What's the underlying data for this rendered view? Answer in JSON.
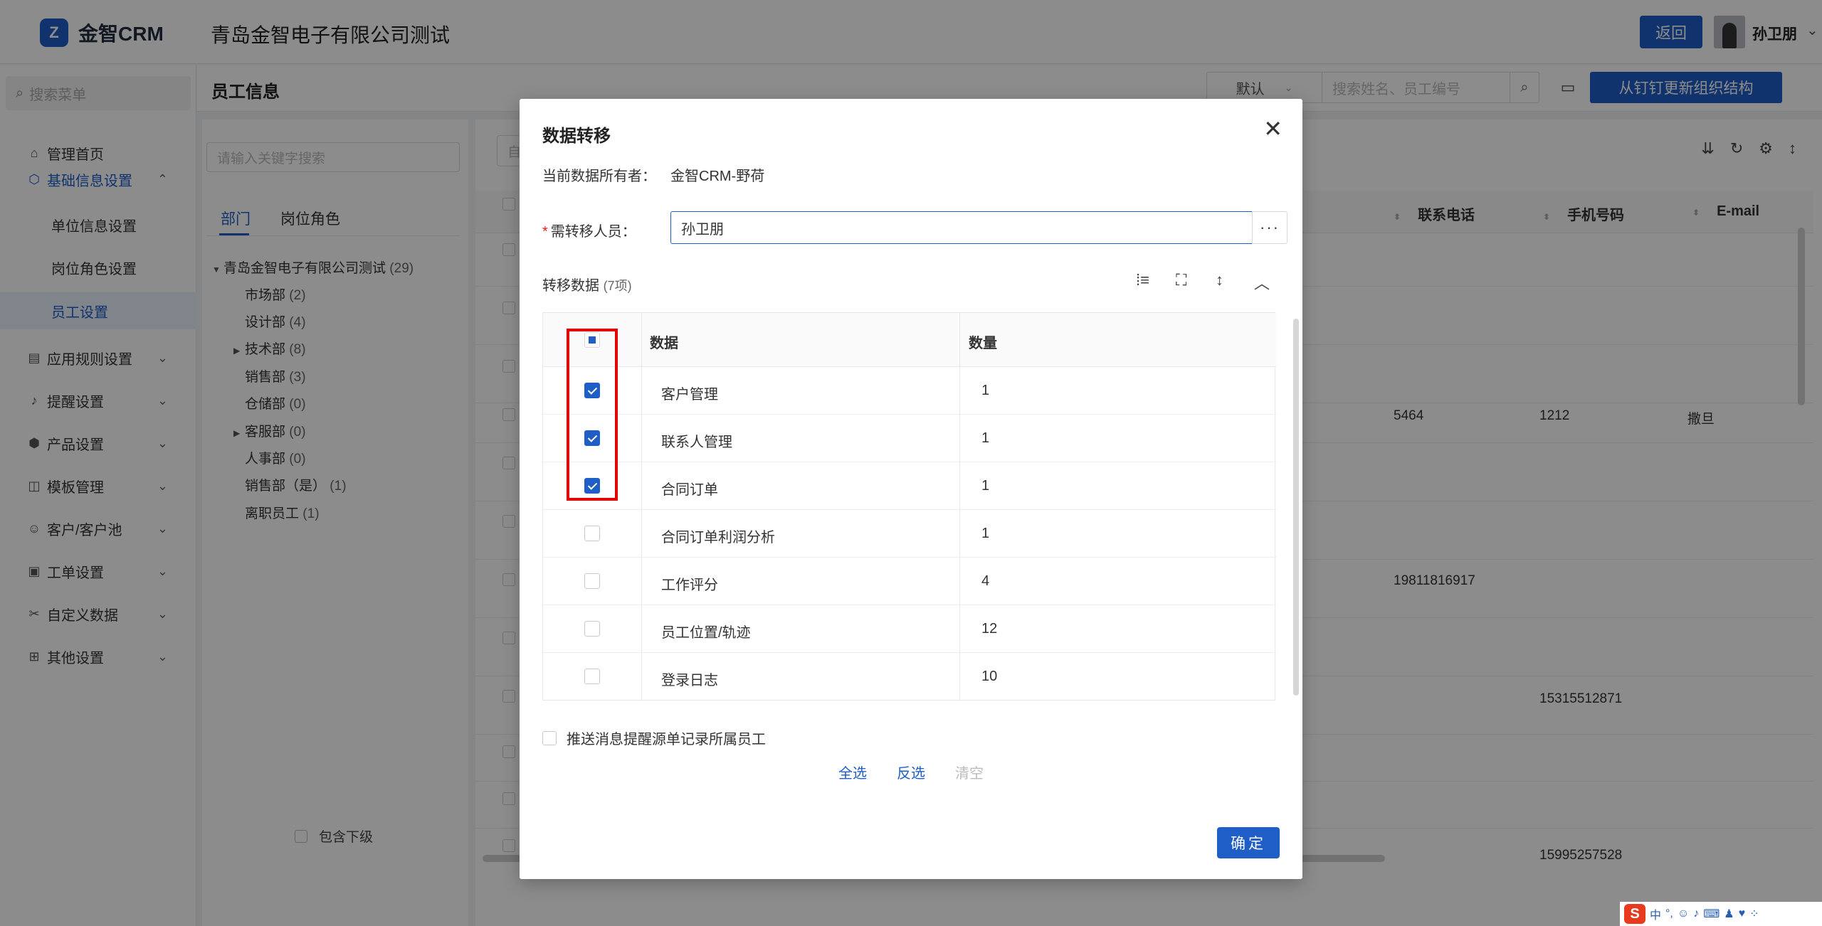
{
  "app": {
    "logo_mark": "Z",
    "name": "金智CRM",
    "company": "青岛金智电子有限公司测试",
    "back": "返回",
    "user": "孙卫朋"
  },
  "sidebar": {
    "search_placeholder": "搜索菜单",
    "items": [
      {
        "label": "管理首页",
        "icon": "home-icon"
      },
      {
        "label": "基础信息设置",
        "icon": "settings-icon"
      },
      {
        "label": "应用规则设置",
        "icon": "doc-icon"
      },
      {
        "label": "提醒设置",
        "icon": "bell-icon"
      },
      {
        "label": "产品设置",
        "icon": "cube-icon"
      },
      {
        "label": "模板管理",
        "icon": "template-icon"
      },
      {
        "label": "客户/客户池",
        "icon": "user-icon"
      },
      {
        "label": "工单设置",
        "icon": "ticket-icon"
      },
      {
        "label": "自定义数据",
        "icon": "tools-icon"
      },
      {
        "label": "其他设置",
        "icon": "grid-icon"
      }
    ],
    "sub_items": [
      "单位信息设置",
      "岗位角色设置",
      "员工设置"
    ]
  },
  "page": {
    "title": "员工信息",
    "sort_default": "默认",
    "search_placeholder": "搜索姓名、员工编号",
    "ding_button": "从钉钉更新组织结构"
  },
  "tree": {
    "search_placeholder": "请输入关键字搜索",
    "tabs": [
      "部门",
      "岗位角色"
    ],
    "root": {
      "label": "青岛金智电子有限公司测试",
      "count": "(29)"
    },
    "nodes": [
      {
        "label": "市场部",
        "count": "(2)"
      },
      {
        "label": "设计部",
        "count": "(4)"
      },
      {
        "label": "技术部",
        "count": "(8)"
      },
      {
        "label": "销售部",
        "count": "(3)"
      },
      {
        "label": "仓储部",
        "count": "(0)"
      },
      {
        "label": "客服部",
        "count": "(0)"
      },
      {
        "label": "人事部",
        "count": "(0)"
      },
      {
        "label": "销售部（是）",
        "count": "(1)"
      },
      {
        "label": "离职员工",
        "count": "(1)"
      }
    ],
    "include_sub": "包含下级"
  },
  "grid": {
    "filter_placeholder": "自",
    "columns": [
      "联系电话",
      "手机号码",
      "E-mail"
    ],
    "cells": [
      "5464",
      "1212",
      "撒旦",
      "19811816917",
      "15315512871",
      "15995257528"
    ]
  },
  "modal": {
    "title": "数据转移",
    "owner_label": "当前数据所有者：",
    "owner_value": "金智CRM-野荷",
    "person_label": "需转移人员：",
    "person_value": "孙卫朋",
    "section_title": "转移数据",
    "section_count": "(7项)",
    "col_data": "数据",
    "col_qty": "数量",
    "rows": [
      {
        "name": "客户管理",
        "qty": "1",
        "checked": true
      },
      {
        "name": "联系人管理",
        "qty": "1",
        "checked": true
      },
      {
        "name": "合同订单",
        "qty": "1",
        "checked": true
      },
      {
        "name": "合同订单利润分析",
        "qty": "1",
        "checked": false
      },
      {
        "name": "工作评分",
        "qty": "4",
        "checked": false
      },
      {
        "name": "员工位置/轨迹",
        "qty": "12",
        "checked": false
      },
      {
        "name": "登录日志",
        "qty": "10",
        "checked": false
      }
    ],
    "push_label": "推送消息提醒源单记录所属员工",
    "select_all": "全选",
    "invert": "反选",
    "clear": "清空",
    "confirm": "确定"
  },
  "ime": {
    "items": [
      "中",
      "°,",
      "☺",
      "♪",
      "⌨",
      "♟",
      "♥",
      "⁘"
    ]
  },
  "colors": {
    "primary": "#1f5ec7",
    "highlight": "#e00000"
  }
}
